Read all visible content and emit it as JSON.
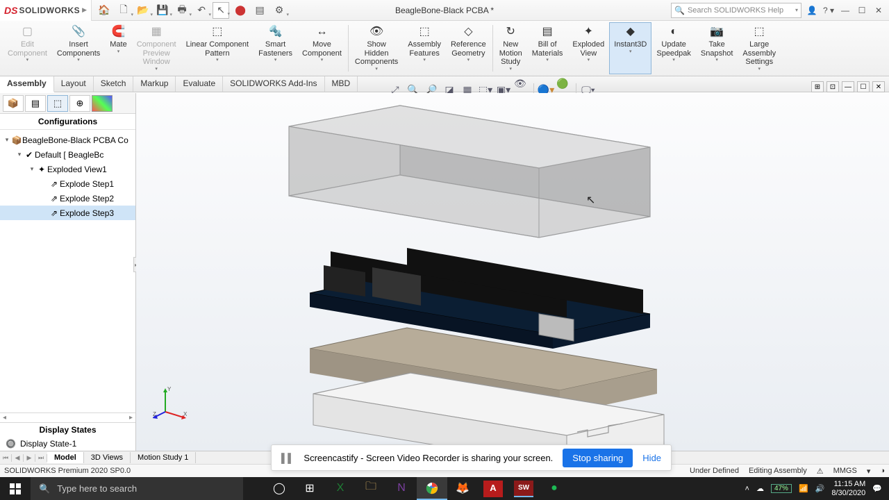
{
  "app": {
    "brand_prefix": "S",
    "brand_name": "SOLIDWORKS",
    "doc_title": "BeagleBone-Black PCBA *",
    "search_placeholder": "Search SOLIDWORKS Help",
    "status_left": "SOLIDWORKS Premium 2020 SP0.0",
    "status_def": "Under Defined",
    "status_mode": "Editing Assembly",
    "status_units": "MMGS"
  },
  "ribbon": [
    {
      "label": "Edit\nComponent",
      "disabled": true
    },
    {
      "label": "Insert\nComponents"
    },
    {
      "label": "Mate"
    },
    {
      "label": "Component\nPreview\nWindow",
      "disabled": true
    },
    {
      "label": "Linear Component\nPattern"
    },
    {
      "label": "Smart\nFasteners"
    },
    {
      "label": "Move\nComponent"
    },
    {
      "sep": true
    },
    {
      "label": "Show\nHidden\nComponents"
    },
    {
      "label": "Assembly\nFeatures"
    },
    {
      "label": "Reference\nGeometry"
    },
    {
      "sep": true
    },
    {
      "label": "New\nMotion\nStudy"
    },
    {
      "label": "Bill of\nMaterials"
    },
    {
      "label": "Exploded\nView"
    },
    {
      "label": "Instant3D",
      "active": true
    },
    {
      "label": "Update\nSpeedpak"
    },
    {
      "label": "Take\nSnapshot"
    },
    {
      "label": "Large\nAssembly\nSettings"
    }
  ],
  "ribbon_icons": [
    "▢",
    "📎",
    "🧲",
    "▦",
    "⬚",
    "🔩",
    "↔",
    "",
    "👁",
    "⬚",
    "◇",
    "",
    "↻",
    "▤",
    "✦",
    "◆",
    "◐",
    "📷",
    "⬚"
  ],
  "cmd_tabs": [
    "Assembly",
    "Layout",
    "Sketch",
    "Markup",
    "Evaluate",
    "SOLIDWORKS Add-Ins",
    "MBD"
  ],
  "leftpane": {
    "header": "Configurations",
    "tree": [
      {
        "indent": 0,
        "tw": "▾",
        "icon": "📦",
        "text": "BeagleBone-Black PCBA Co"
      },
      {
        "indent": 1,
        "tw": "▾",
        "icon": "✔",
        "text": "Default [ BeagleBc"
      },
      {
        "indent": 2,
        "tw": "▾",
        "icon": "✦",
        "text": "Exploded View1"
      },
      {
        "indent": 3,
        "tw": "",
        "icon": "⇗",
        "text": "Explode Step1"
      },
      {
        "indent": 3,
        "tw": "",
        "icon": "⇗",
        "text": "Explode Step2"
      },
      {
        "indent": 3,
        "tw": "",
        "icon": "⇗",
        "text": "Explode Step3",
        "sel": true
      }
    ],
    "display_states_header": "Display States",
    "display_state": "Display State-1"
  },
  "bottom_tabs": [
    "Model",
    "3D Views",
    "Motion Study 1"
  ],
  "notification": {
    "text": "Screencastify - Screen Video Recorder is sharing your screen.",
    "stop": "Stop sharing",
    "hide": "Hide"
  },
  "taskbar": {
    "search_placeholder": "Type here to search",
    "battery": "47%",
    "time": "11:15 AM",
    "date": "8/30/2020"
  },
  "chart_data": null
}
